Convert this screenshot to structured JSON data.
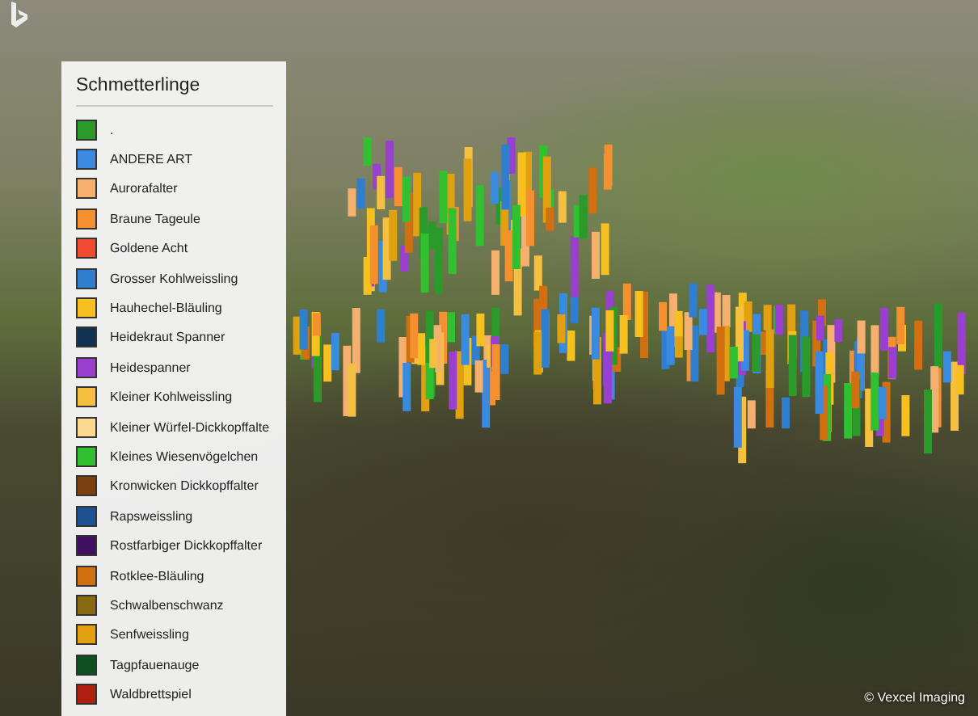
{
  "legend": {
    "title": "Schmetterlinge",
    "items": [
      {
        "label": ".",
        "color": "#2a9a2a"
      },
      {
        "label": "ANDERE ART",
        "color": "#3a8ae0"
      },
      {
        "label": "Aurorafalter",
        "color": "#f5b070"
      },
      {
        "label": "Braune Tageule",
        "color": "#f59030"
      },
      {
        "label": "Goldene Acht",
        "color": "#f04a30"
      },
      {
        "label": "Grosser Kohlweissling",
        "color": "#2f7fd0"
      },
      {
        "label": "Hauhechel-Bläuling",
        "color": "#f5c020"
      },
      {
        "label": "Heidekraut Spanner",
        "color": "#123050"
      },
      {
        "label": "Heidespanner",
        "color": "#9a40d0"
      },
      {
        "label": "Kleiner Kohlweissling",
        "color": "#f5c040"
      },
      {
        "label": "Kleiner Würfel-Dickkopffalte",
        "color": "#fcd890"
      },
      {
        "label": "Kleines Wiesenvögelchen",
        "color": "#30c030"
      },
      {
        "label": "Kronwicken Dickkopffalter",
        "color": "#7a4010"
      },
      {
        "label": "Rapsweissling",
        "color": "#1f5090"
      },
      {
        "label": "Rostfarbiger Dickkopffalter",
        "color": "#401060"
      },
      {
        "label": "Rotklee-Bläuling",
        "color": "#d07010"
      },
      {
        "label": "Schwalbenschwanz",
        "color": "#8a6a10"
      },
      {
        "label": "Senfweissling",
        "color": "#e0a010"
      },
      {
        "label": "Tagpfauenauge",
        "color": "#0f5020"
      },
      {
        "label": "Waldbrettspiel",
        "color": "#b02010"
      }
    ]
  },
  "attribution": "© Vexcel Imaging"
}
